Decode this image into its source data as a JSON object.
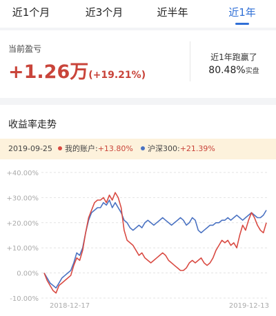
{
  "tabs": [
    {
      "label": "近1个月",
      "active": false
    },
    {
      "label": "近3个月",
      "active": false
    },
    {
      "label": "近半年",
      "active": false
    },
    {
      "label": "近1年",
      "active": true
    }
  ],
  "summary": {
    "pl_label": "当前盈亏",
    "pl_value": "+1.26万",
    "pl_pct": "(+19.21%)",
    "beat_label": "近1年跑赢了",
    "beat_value": "80.48%",
    "beat_tag": "实盘"
  },
  "chart_section": {
    "title": "收益率走势"
  },
  "legend": {
    "date": "2019-09-25",
    "series1_name": "我的账户:",
    "series1_value": "+13.80%",
    "series2_name": "沪深300:",
    "series2_value": "+21.39%"
  },
  "colors": {
    "accent": "#2f6fd6",
    "account": "#d94a42",
    "index": "#4a72c2",
    "highlight_bg": "#fdf2dc"
  },
  "chart_data": {
    "type": "line",
    "ylim": [
      -10,
      40
    ],
    "yticks": [
      -10,
      0,
      10,
      20,
      30,
      40
    ],
    "ytick_labels": [
      "-10.00%",
      "0.00%",
      "+10.00%",
      "+20.00%",
      "+30.00%",
      "+40.00%"
    ],
    "xtick_labels": [
      "2018-12-17",
      "2019-12-13"
    ],
    "series": [
      {
        "name": "我的账户",
        "color": "#d94a42",
        "values": [
          0,
          -3,
          -5,
          -7,
          -8,
          -5,
          -4,
          -3,
          -2,
          -1,
          3,
          6,
          5,
          9,
          16,
          22,
          25,
          28,
          29,
          29,
          30,
          28,
          31,
          29,
          32,
          30,
          26,
          17,
          13,
          12,
          11,
          9,
          7,
          8,
          6,
          5,
          4,
          5,
          6,
          7,
          8,
          7,
          5,
          4,
          3,
          2,
          1,
          1,
          2,
          4,
          5,
          4,
          5,
          6,
          4,
          3,
          4,
          6,
          9,
          11,
          13,
          12,
          13,
          11,
          12,
          10,
          15,
          19,
          17,
          21,
          24,
          22,
          19,
          17,
          16,
          20
        ]
      },
      {
        "name": "沪深300",
        "color": "#4a72c2",
        "values": [
          0,
          -2,
          -4,
          -5,
          -6,
          -4,
          -2,
          -1,
          0,
          1,
          4,
          8,
          7,
          10,
          16,
          21,
          24,
          25,
          26,
          26,
          28,
          27,
          29,
          26,
          28,
          26,
          24,
          21,
          20,
          18,
          17,
          18,
          19,
          18,
          20,
          21,
          20,
          19,
          20,
          21,
          22,
          21,
          20,
          19,
          20,
          21,
          22,
          21,
          19,
          20,
          22,
          21,
          17,
          16,
          17,
          18,
          19,
          19,
          20,
          20,
          21,
          21,
          22,
          21,
          22,
          23,
          22,
          21,
          22,
          23,
          24,
          23,
          22,
          22,
          23,
          25
        ]
      }
    ]
  }
}
